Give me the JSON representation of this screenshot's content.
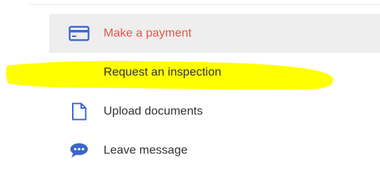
{
  "menu": {
    "items": [
      {
        "label": "Make a payment",
        "icon": "credit-card-icon",
        "active": true
      },
      {
        "label": "Request an inspection",
        "icon": "calendar-check-icon",
        "active": false
      },
      {
        "label": "Upload documents",
        "icon": "document-icon",
        "active": false
      },
      {
        "label": "Leave message",
        "icon": "chat-bubble-icon",
        "active": false
      }
    ]
  },
  "colors": {
    "active_text": "#e8534a",
    "text": "#333333",
    "icon_blue": "#3a66cc",
    "active_bg": "#eeeeee",
    "highlight": "#ffff00"
  }
}
